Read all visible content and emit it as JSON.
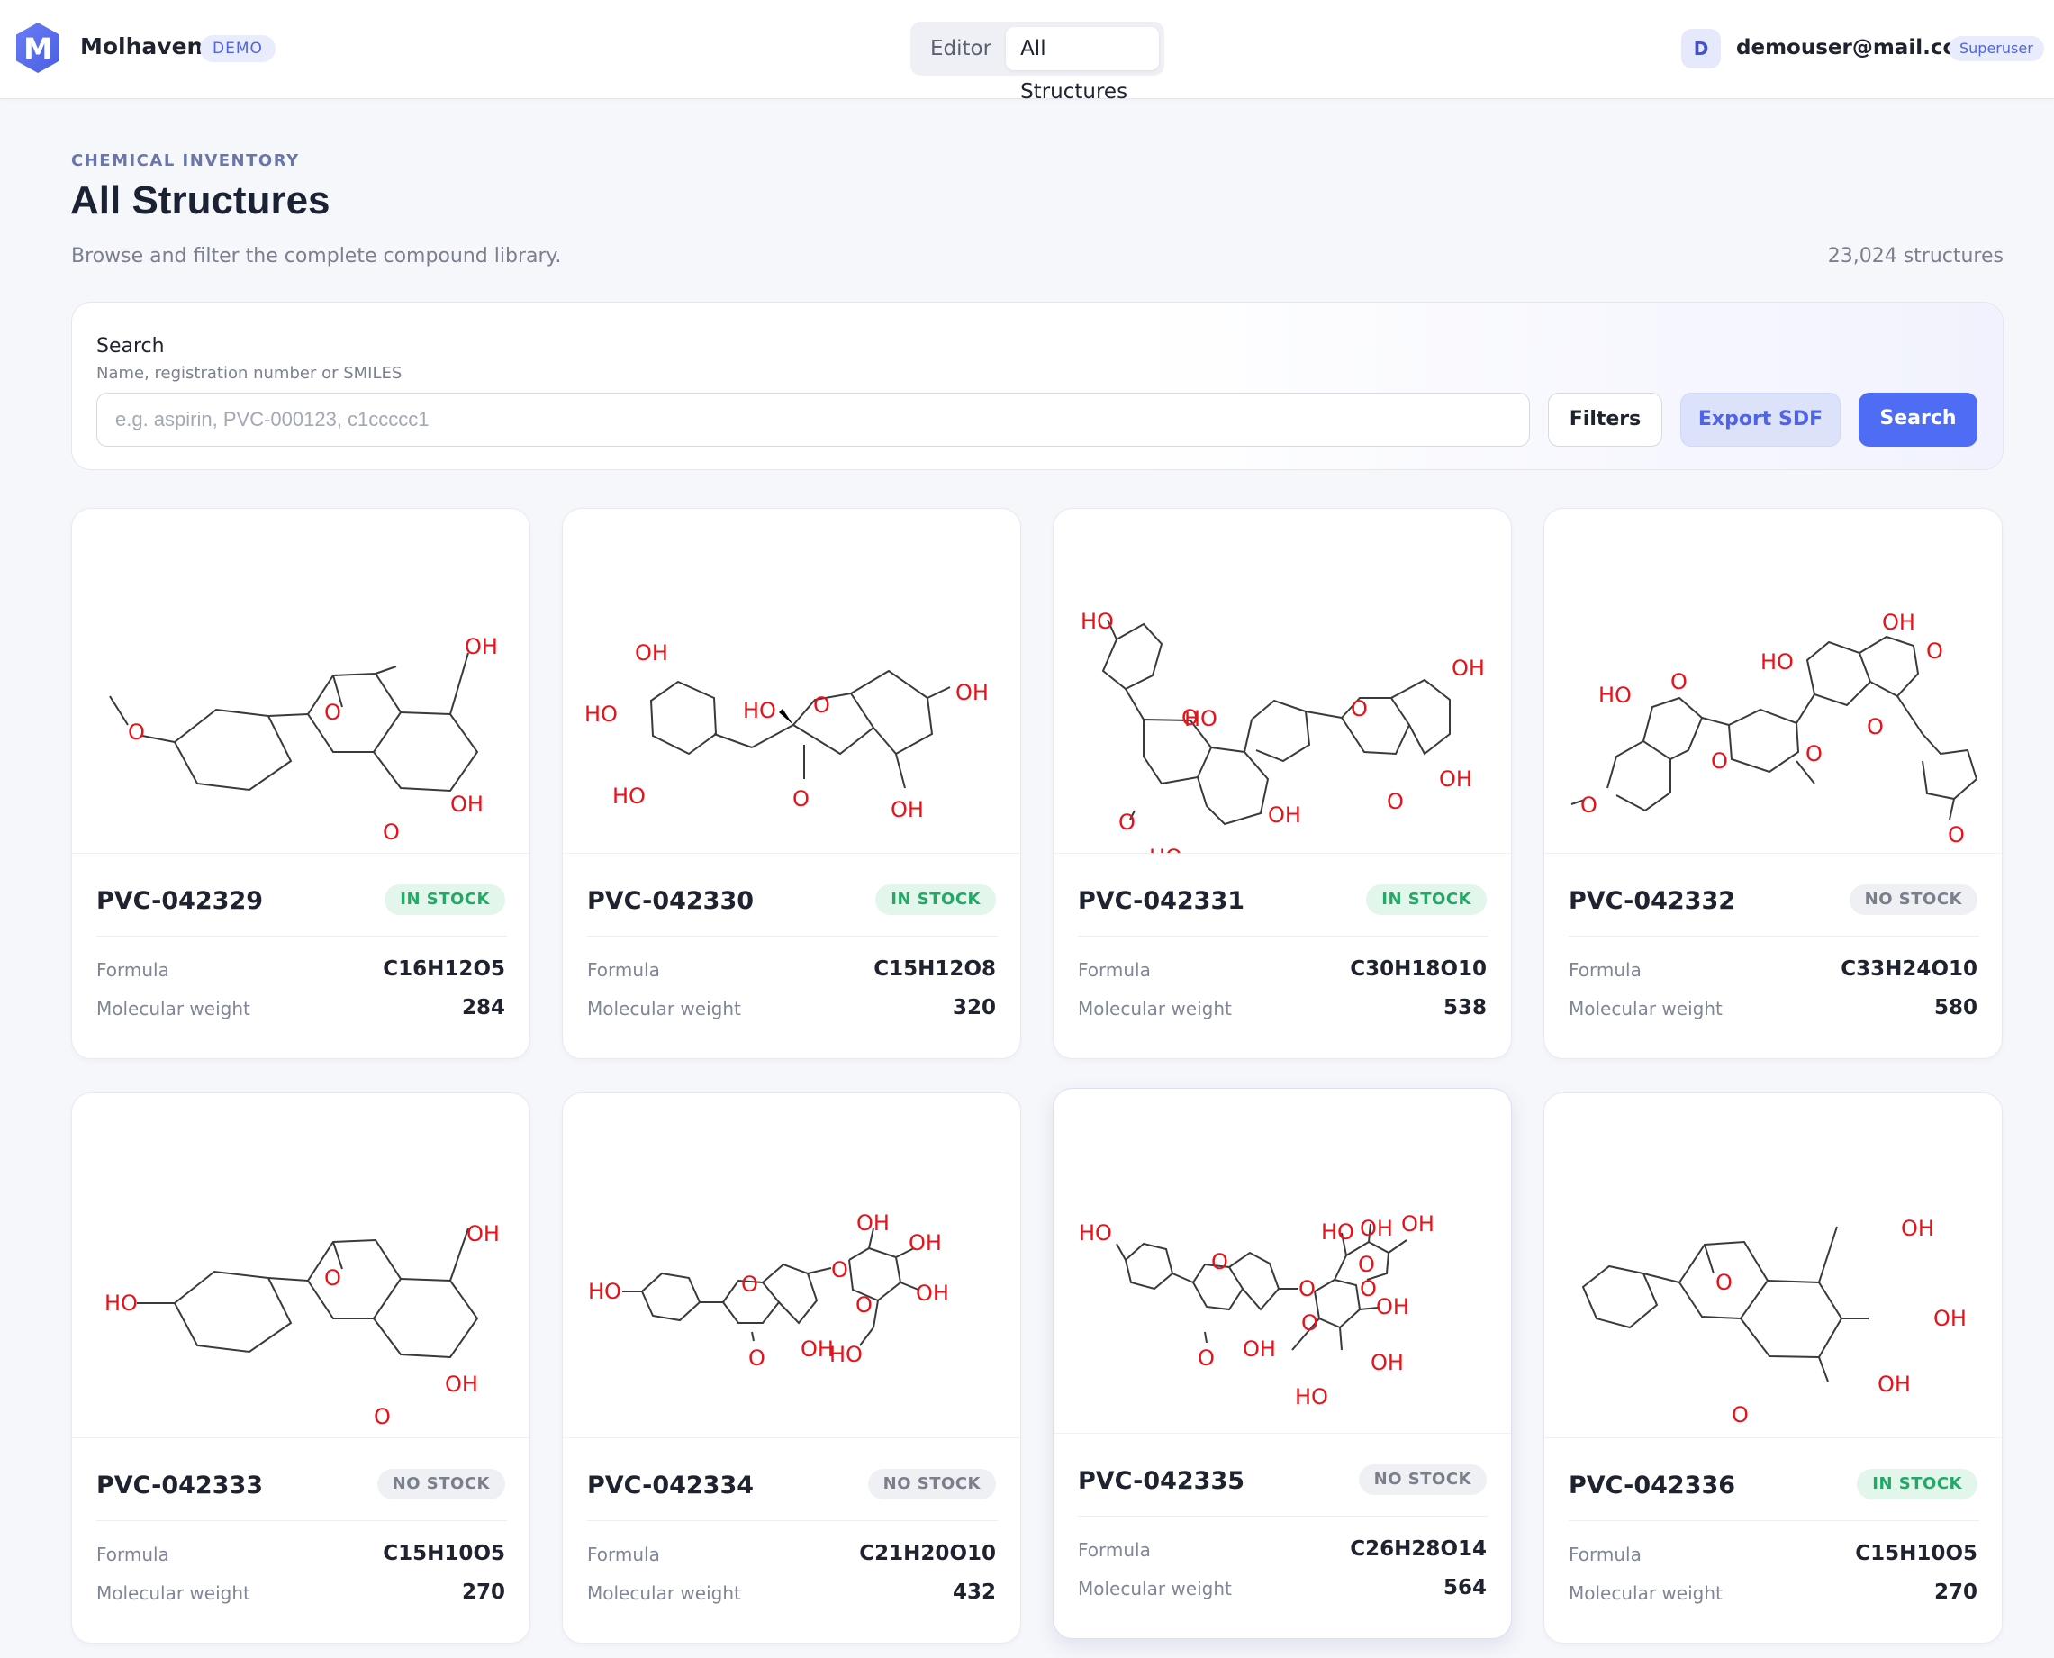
{
  "app": {
    "name": "Molhaven",
    "env_badge": "DEMO",
    "logo_letter": "M",
    "accent": "#4f6cf5"
  },
  "nav": {
    "tabs": [
      {
        "label": "Editor",
        "active": false
      },
      {
        "label": "All Structures",
        "active": true
      }
    ]
  },
  "user": {
    "avatar_initial": "D",
    "email": "demouser@mail.com",
    "role": "Superuser"
  },
  "page": {
    "eyebrow": "CHEMICAL INVENTORY",
    "title": "All Structures",
    "description": "Browse and filter the complete compound library.",
    "count": "23,024 structures"
  },
  "search": {
    "label": "Search",
    "help": "Name, registration number or SMILES",
    "placeholder": "e.g. aspirin, PVC-000123, c1ccccc1",
    "value": "",
    "filters_label": "Filters",
    "export_label": "Export SDF",
    "search_label": "Search"
  },
  "labels": {
    "formula": "Formula",
    "mw": "Molecular weight"
  },
  "cards": [
    {
      "reg": "PVC-042329",
      "stock": "IN STOCK",
      "in_stock": true,
      "formula": "C16H12O5",
      "mw": "284"
    },
    {
      "reg": "PVC-042330",
      "stock": "IN STOCK",
      "in_stock": true,
      "formula": "C15H12O8",
      "mw": "320"
    },
    {
      "reg": "PVC-042331",
      "stock": "IN STOCK",
      "in_stock": true,
      "formula": "C30H18O10",
      "mw": "538"
    },
    {
      "reg": "PVC-042332",
      "stock": "NO STOCK",
      "in_stock": false,
      "formula": "C33H24O10",
      "mw": "580"
    },
    {
      "reg": "PVC-042333",
      "stock": "NO STOCK",
      "in_stock": false,
      "formula": "C15H10O5",
      "mw": "270"
    },
    {
      "reg": "PVC-042334",
      "stock": "NO STOCK",
      "in_stock": false,
      "formula": "C21H20O10",
      "mw": "432"
    },
    {
      "reg": "PVC-042335",
      "stock": "NO STOCK",
      "in_stock": false,
      "formula": "C26H28O14",
      "mw": "564"
    },
    {
      "reg": "PVC-042336",
      "stock": "IN STOCK",
      "in_stock": true,
      "formula": "C15H10O5",
      "mw": "270"
    }
  ],
  "atom_labels": {
    "OH": "OH",
    "HO": "HO",
    "O": "O"
  },
  "colors": {
    "bond": "#3a3a3a",
    "heteroatom": "#e8131a",
    "in_stock_bg": "#e2f6ec",
    "in_stock_fg": "#23a867",
    "no_stock_bg": "#eef0f3",
    "no_stock_fg": "#7a7f8c"
  }
}
